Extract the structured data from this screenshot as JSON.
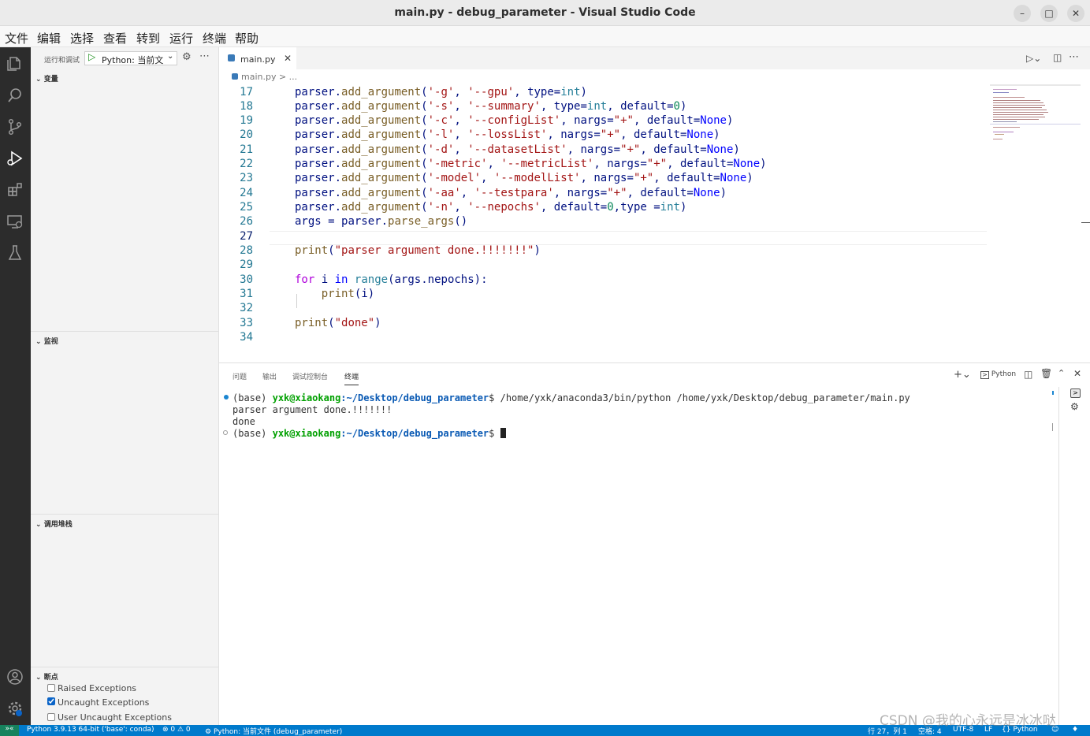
{
  "window": {
    "title": "main.py - debug_parameter - Visual Studio Code"
  },
  "menu": [
    "文件",
    "编辑",
    "选择",
    "查看",
    "转到",
    "运行",
    "终端",
    "帮助"
  ],
  "sidebar": {
    "run_label": "运行和调试",
    "config": "Python: 当前文",
    "sections": {
      "variables": "变量",
      "watch": "监视",
      "callstack": "调用堆栈",
      "breakpoints": "断点"
    },
    "breakpoints": [
      {
        "label": "Raised Exceptions",
        "checked": false
      },
      {
        "label": "Uncaught Exceptions",
        "checked": true
      },
      {
        "label": "User Uncaught Exceptions",
        "checked": false
      }
    ]
  },
  "editor": {
    "tab": "main.py",
    "breadcrumb": "main.py > ...",
    "line_numbers": [
      "17",
      "18",
      "19",
      "20",
      "21",
      "22",
      "23",
      "24",
      "25",
      "26",
      "27",
      "28",
      "29",
      "30",
      "31",
      "32",
      "33",
      "34"
    ]
  },
  "panel": {
    "tabs": [
      "问题",
      "输出",
      "调试控制台",
      "终端"
    ],
    "shell_label": "Python",
    "prompt_user": "yxk@xiaokang",
    "prompt_path": ":~/Desktop/debug_parameter",
    "prompt_base": "(base)",
    "command": "$ /home/yxk/anaconda3/bin/python /home/yxk/Desktop/debug_parameter/main.py",
    "output1": "parser argument done.!!!!!!!",
    "output2": "done",
    "prompt_end": "$"
  },
  "status": {
    "interpreter": "Python 3.9.13 64-bit ('base': conda)",
    "problems": "⊗ 0 ⚠ 0",
    "debug": "Python: 当前文件 (debug_parameter)",
    "position": "行 27，列 1",
    "spaces": "空格: 4",
    "encoding": "UTF-8",
    "eol": "LF",
    "language": "Python"
  },
  "watermark": "CSDN @我的心永远是冰冰哒"
}
